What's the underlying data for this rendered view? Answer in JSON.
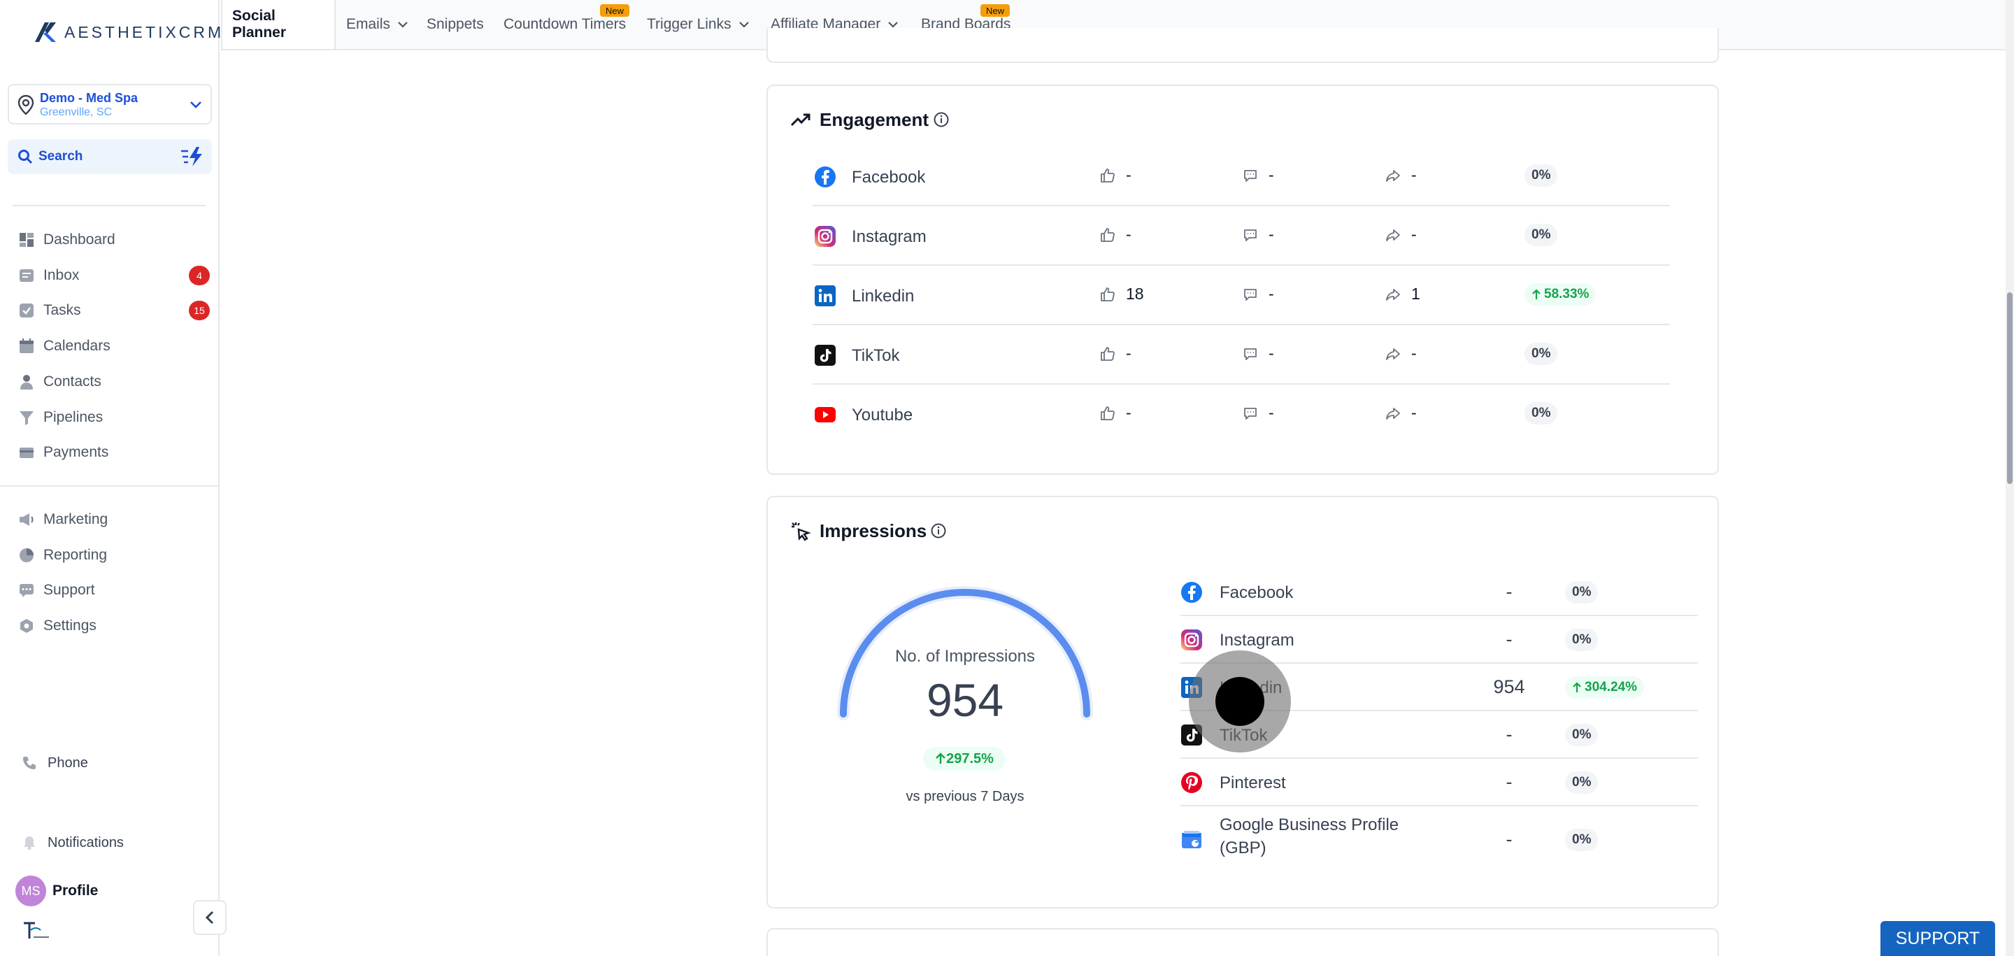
{
  "brand": {
    "logo_text": "AESTHETIXCRM"
  },
  "location": {
    "name": "Demo - Med Spa",
    "city": "Greenville, SC"
  },
  "search": {
    "label": "Search"
  },
  "sidebar": {
    "items": [
      {
        "label": "Dashboard",
        "icon": "dashboard-icon"
      },
      {
        "label": "Inbox",
        "icon": "inbox-icon",
        "badge": "4"
      },
      {
        "label": "Tasks",
        "icon": "tasks-icon",
        "badge": "15"
      },
      {
        "label": "Calendars",
        "icon": "calendar-icon"
      },
      {
        "label": "Contacts",
        "icon": "contacts-icon"
      },
      {
        "label": "Pipelines",
        "icon": "pipelines-icon"
      },
      {
        "label": "Payments",
        "icon": "payments-icon"
      },
      {
        "label": "Marketing",
        "icon": "marketing-icon"
      },
      {
        "label": "Reporting",
        "icon": "reporting-icon"
      },
      {
        "label": "Support",
        "icon": "support-icon"
      },
      {
        "label": "Settings",
        "icon": "settings-icon"
      }
    ],
    "phone": "Phone",
    "notifications": "Notifications",
    "profile": {
      "initials": "MS",
      "label": "Profile"
    }
  },
  "topnav": {
    "tabs": [
      {
        "label": "Social Planner"
      },
      {
        "label": "Emails"
      },
      {
        "label": "Snippets"
      },
      {
        "label": "Countdown Timers",
        "badge": "New"
      },
      {
        "label": "Trigger Links"
      },
      {
        "label": "Affiliate Manager"
      },
      {
        "label": "Brand Boards",
        "badge": "New"
      }
    ]
  },
  "engagement": {
    "title": "Engagement",
    "rows": [
      {
        "platform": "Facebook",
        "likes": "-",
        "comments": "-",
        "shares": "-",
        "change": "0%",
        "up": false
      },
      {
        "platform": "Instagram",
        "likes": "-",
        "comments": "-",
        "shares": "-",
        "change": "0%",
        "up": false
      },
      {
        "platform": "Linkedin",
        "likes": "18",
        "comments": "-",
        "shares": "1",
        "change": "58.33%",
        "up": true
      },
      {
        "platform": "TikTok",
        "likes": "-",
        "comments": "-",
        "shares": "-",
        "change": "0%",
        "up": false
      },
      {
        "platform": "Youtube",
        "likes": "-",
        "comments": "-",
        "shares": "-",
        "change": "0%",
        "up": false
      }
    ]
  },
  "impressions": {
    "title": "Impressions",
    "gauge": {
      "label": "No. of Impressions",
      "value": "954",
      "change": "297.5%",
      "vs_label": "vs previous 7 Days"
    },
    "rows": [
      {
        "platform": "Facebook",
        "value": "-",
        "change": "0%",
        "up": false
      },
      {
        "platform": "Instagram",
        "value": "-",
        "change": "0%",
        "up": false
      },
      {
        "platform": "Linkedin",
        "value": "954",
        "change": "304.24%",
        "up": true
      },
      {
        "platform": "TikTok",
        "value": "-",
        "change": "0%",
        "up": false
      },
      {
        "platform": "Pinterest",
        "value": "-",
        "change": "0%",
        "up": false
      },
      {
        "platform": "Google Business Profile (GBP)",
        "value": "-",
        "change": "0%",
        "up": false
      }
    ]
  },
  "support_button": "SUPPORT",
  "colors": {
    "accent": "#1d4ed8",
    "positive": "#16a34a",
    "badge": "#dc2626",
    "new_badge": "#f59e0b"
  }
}
